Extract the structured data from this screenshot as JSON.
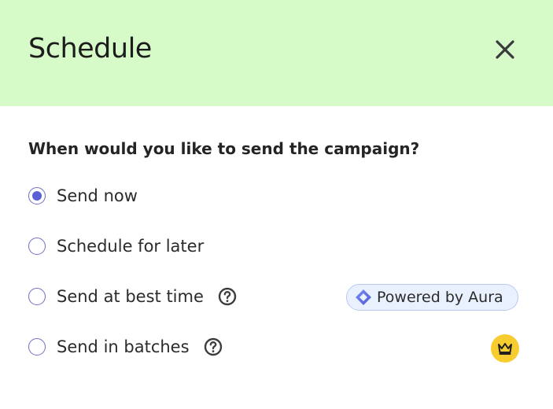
{
  "dialog": {
    "title": "Schedule",
    "close_icon": "close-icon"
  },
  "question": "When would you like to send the campaign?",
  "options": [
    {
      "label": "Send now",
      "selected": true
    },
    {
      "label": "Schedule for later",
      "selected": false
    },
    {
      "label": "Send at best time",
      "selected": false,
      "help_icon": "question-circle-icon"
    },
    {
      "label": "Send in batches",
      "selected": false,
      "help_icon": "question-circle-icon"
    }
  ],
  "aura_badge": {
    "label": "Powered by Aura",
    "icon": "aura-diamond-icon"
  },
  "premium_badge": {
    "icon": "crown-icon",
    "color": "#f7cc2e"
  },
  "colors": {
    "header_bg": "#d6fbc8",
    "accent": "#5a5fd6",
    "badge_bg": "#eaf1fe"
  }
}
